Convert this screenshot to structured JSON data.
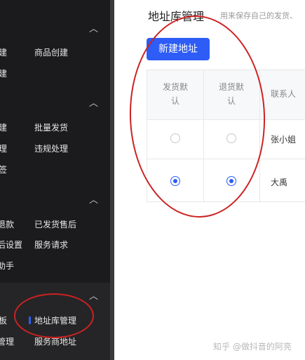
{
  "sidebar": {
    "groups": [
      {
        "items": [
          "建",
          "商品创建",
          "建"
        ]
      },
      {
        "items": [
          "建",
          "批量发货",
          "理",
          "违规处理",
          "签"
        ]
      },
      {
        "items": [
          "退款",
          "已发货售后",
          "后设置",
          "服务请求",
          "助手"
        ]
      },
      {
        "items": [
          "板",
          "地址库管理",
          "管理",
          "服务商地址"
        ]
      }
    ],
    "active_item": "地址库管理"
  },
  "main": {
    "title": "地址库管理",
    "subtitle": "用来保存自己的发货、",
    "new_button": "新建地址",
    "table": {
      "headers": [
        "发货默认",
        "退货默认",
        "联系人"
      ],
      "rows": [
        {
          "ship_default": false,
          "return_default": false,
          "contact": "张小姐"
        },
        {
          "ship_default": true,
          "return_default": true,
          "contact": "大禹"
        }
      ]
    }
  },
  "watermark": "知乎 @做抖音的阿亮",
  "colors": {
    "accent": "#2d5cf6",
    "annotation": "#cc2222",
    "sidebar_bg": "#1b1b1d"
  }
}
